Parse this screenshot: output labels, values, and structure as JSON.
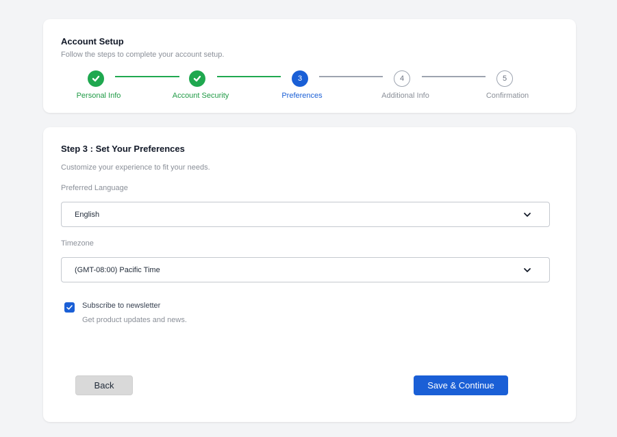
{
  "header": {
    "title": "Account Setup",
    "subtitle": "Follow the steps to complete your account setup."
  },
  "stepper": {
    "steps": [
      {
        "number": "1",
        "label": "Personal Info",
        "status": "done"
      },
      {
        "number": "2",
        "label": "Account Security",
        "status": "done"
      },
      {
        "number": "3",
        "label": "Preferences",
        "status": "active"
      },
      {
        "number": "4",
        "label": "Additional Info",
        "status": "pending"
      },
      {
        "number": "5",
        "label": "Confirmation",
        "status": "pending"
      }
    ]
  },
  "form": {
    "title": "Step 3 : Set Your Preferences",
    "subtitle": "Customize your experience to fit your needs.",
    "language": {
      "label": "Preferred Language",
      "value": "English"
    },
    "timezone": {
      "label": "Timezone",
      "value": "(GMT-08:00) Pacific Time"
    },
    "newsletter": {
      "label": "Subscribe to newsletter",
      "description": "Get product updates and news.",
      "checked": true
    }
  },
  "actions": {
    "back_label": "Back",
    "save_label": "Save & Continue"
  },
  "colors": {
    "primary": "#1a5fd6",
    "success": "#1fa84f",
    "pending": "#9ca3af"
  }
}
